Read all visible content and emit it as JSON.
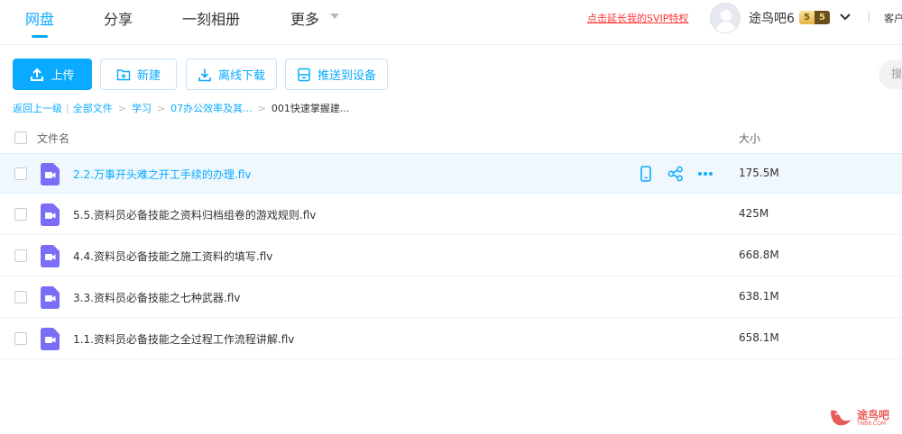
{
  "nav": {
    "tabs": [
      {
        "label": "网盘",
        "active": true
      },
      {
        "label": "分享",
        "active": false
      },
      {
        "label": "一刻相册",
        "active": false
      },
      {
        "label": "更多",
        "active": false
      }
    ],
    "svip_link": "点击延长我的SVIP特权",
    "username": "途鸟吧6",
    "vip_level": "5",
    "vip_level_2": "5",
    "client_link": "客户端"
  },
  "toolbar": {
    "upload_label": "上传",
    "new_label": "新建",
    "offline_download_label": "离线下载",
    "push_device_label": "推送到设备",
    "search_placeholder": "搜"
  },
  "breadcrumb": {
    "back": "返回上一级",
    "items": [
      "全部文件",
      "学习",
      "07办公效率及其...",
      "001快速掌握建..."
    ]
  },
  "table": {
    "columns": {
      "name": "文件名",
      "size": "大小"
    },
    "rows": [
      {
        "name": "2.2.万事开头难之开工手续的办理.flv",
        "size": "175.5M",
        "hovered": true
      },
      {
        "name": "5.5.资料员必备技能之资料归档组卷的游戏规则.flv",
        "size": "425M",
        "hovered": false
      },
      {
        "name": "4.4.资料员必备技能之施工资料的填写.flv",
        "size": "668.8M",
        "hovered": false
      },
      {
        "name": "3.3.资料员必备技能之七种武器.flv",
        "size": "638.1M",
        "hovered": false
      },
      {
        "name": "1.1.资料员必备技能之全过程工作流程讲解.flv",
        "size": "658.1M",
        "hovered": false
      }
    ]
  },
  "watermark": {
    "text": "途鸟吧",
    "sub": "TNB8.COM"
  },
  "colors": {
    "accent": "#09aaff",
    "link_red": "#ff3333",
    "video_icon": "#7b6ef6",
    "row_hover": "#f0f8fe"
  },
  "icons": [
    "upload-icon",
    "new-folder-icon",
    "download-icon",
    "device-icon",
    "video-file-icon",
    "phone-icon",
    "share-icon",
    "more-icon",
    "chevron-down-icon"
  ]
}
